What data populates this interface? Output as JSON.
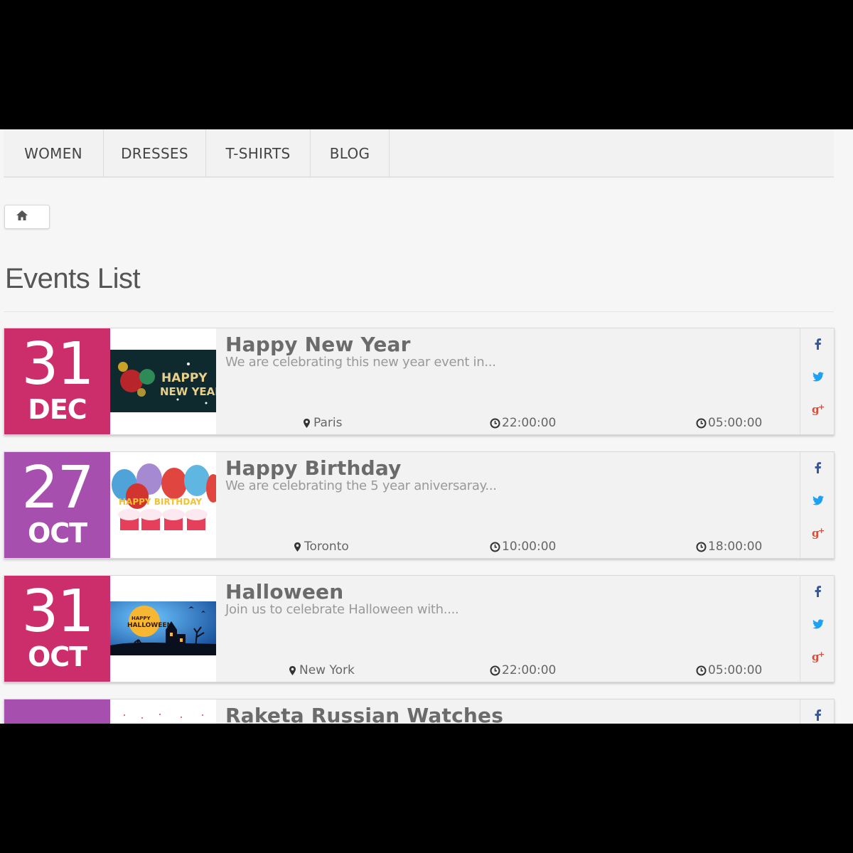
{
  "nav": {
    "items": [
      {
        "label": "WOMEN"
      },
      {
        "label": "DRESSES"
      },
      {
        "label": "T-SHIRTS"
      },
      {
        "label": "BLOG"
      }
    ]
  },
  "breadcrumb": {
    "home_icon": "home-icon"
  },
  "page": {
    "title": "Events List"
  },
  "colors": {
    "pink": "#cc2e6c",
    "purple": "#a74fae"
  },
  "events": [
    {
      "day": "31",
      "month": "DEC",
      "title": "Happy New Year",
      "description": "We are celebrating this new year event in...",
      "location": "Paris",
      "start": "22:00:00",
      "end": "05:00:00",
      "accent": "#cc2e6c",
      "image": "new-year-image"
    },
    {
      "day": "27",
      "month": "OCT",
      "title": "Happy Birthday",
      "description": "We are celebrating the 5 year aniversaray...",
      "location": "Toronto",
      "start": "10:00:00",
      "end": "18:00:00",
      "accent": "#a74fae",
      "image": "birthday-image"
    },
    {
      "day": "31",
      "month": "OCT",
      "title": "Halloween",
      "description": "Join us to celebrate Halloween with....",
      "location": "New York",
      "start": "22:00:00",
      "end": "05:00:00",
      "accent": "#cc2e6c",
      "image": "halloween-image"
    },
    {
      "day": "",
      "month": "",
      "title": "Raketa Russian Watches",
      "description": "",
      "location": "",
      "start": "",
      "end": "",
      "accent": "#a74fae",
      "image": "watches-image"
    }
  ],
  "social": {
    "facebook": "facebook-icon",
    "twitter": "twitter-icon",
    "google_plus": "google-plus-icon"
  }
}
